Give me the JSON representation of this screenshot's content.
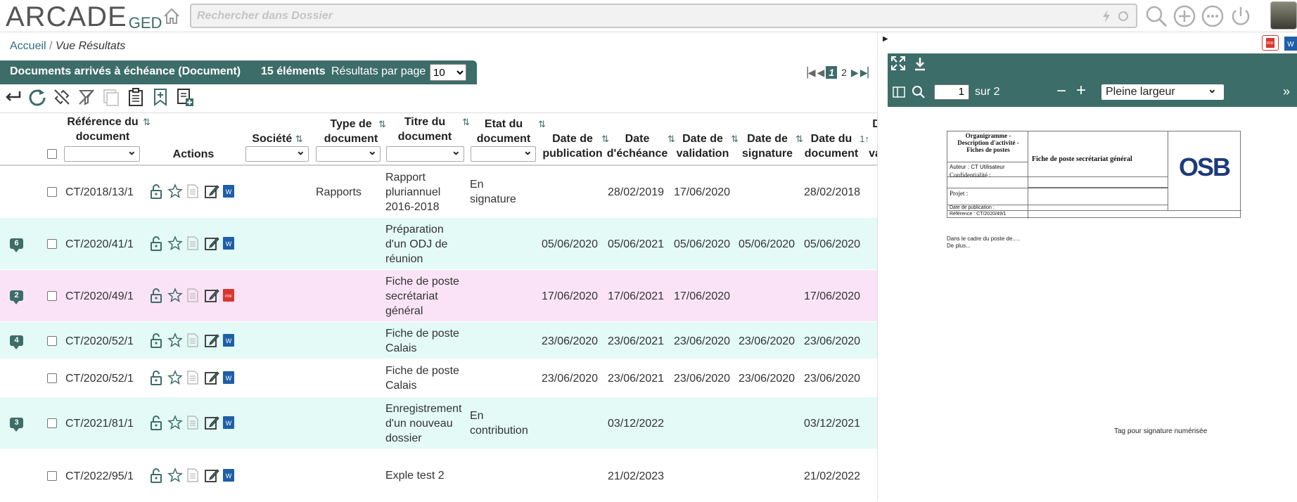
{
  "app": {
    "logo_text": "ARCADE",
    "logo_sub": "GED",
    "search_placeholder": "Rechercher dans Dossier"
  },
  "breadcrumb": {
    "home": "Accueil",
    "separator": "/",
    "current": "Vue Résultats"
  },
  "results": {
    "title": "Documents arrivés à échéance (Document)",
    "count": "15 éléments",
    "per_page_label": "Résultats par page",
    "per_page_value": "10",
    "per_page_options": [
      "10"
    ],
    "pages": [
      "1",
      "2"
    ],
    "current_page": "1"
  },
  "columns": {
    "reference": "Référence du document",
    "actions": "Actions",
    "societe": "Société",
    "type": "Type de document",
    "titre": "Titre du document",
    "etat": "Etat du document",
    "publication": "Date de publication",
    "echeance": "Date d'échéance",
    "validation": "Date de validation",
    "signature": "Date de signature",
    "date_doc": "Date du document",
    "date_doc_sort": "1",
    "extra_d": "D",
    "extra_va": "va"
  },
  "rows": [
    {
      "badge": "",
      "ref": "CT/2018/13/1",
      "type": "Rapports",
      "titre": [
        "Rapport",
        "pluriannuel",
        "2016-2018"
      ],
      "etat": [
        "En",
        "signature"
      ],
      "publication": "",
      "echeance": "28/02/2019",
      "validation": "17/06/2020",
      "signature": "",
      "date_doc": "28/02/2018",
      "filetype": "word",
      "bg": "#ffffff"
    },
    {
      "badge": "6",
      "ref": "CT/2020/41/1",
      "type": "",
      "titre": [
        "Préparation",
        "d'un ODJ de",
        "réunion"
      ],
      "etat": [],
      "publication": "05/06/2020",
      "echeance": "05/06/2021",
      "validation": "05/06/2020",
      "signature": "05/06/2020",
      "date_doc": "05/06/2020",
      "filetype": "word",
      "bg": "#e3faf6"
    },
    {
      "badge": "2",
      "ref": "CT/2020/49/1",
      "type": "",
      "titre": [
        "Fiche de poste",
        "secrétariat",
        "général"
      ],
      "etat": [],
      "publication": "17/06/2020",
      "echeance": "17/06/2021",
      "validation": "17/06/2020",
      "signature": "",
      "date_doc": "17/06/2020",
      "filetype": "pdf",
      "bg": "#fbe3f7"
    },
    {
      "badge": "4",
      "ref": "CT/2020/52/1",
      "type": "",
      "titre": [
        "Fiche de poste",
        "Calais"
      ],
      "etat": [],
      "publication": "23/06/2020",
      "echeance": "23/06/2021",
      "validation": "23/06/2020",
      "signature": "23/06/2020",
      "date_doc": "23/06/2020",
      "filetype": "word",
      "bg": "#e3faf6"
    },
    {
      "badge": "",
      "ref": "CT/2020/52/1",
      "type": "",
      "titre": [
        "Fiche de poste",
        "Calais"
      ],
      "etat": [],
      "publication": "23/06/2020",
      "echeance": "23/06/2021",
      "validation": "23/06/2020",
      "signature": "23/06/2020",
      "date_doc": "23/06/2020",
      "filetype": "word",
      "bg": "#ffffff"
    },
    {
      "badge": "3",
      "ref": "CT/2021/81/1",
      "type": "",
      "titre": [
        "Enregistrement",
        "d'un nouveau",
        "dossier"
      ],
      "etat": [
        "En",
        "contribution"
      ],
      "publication": "",
      "echeance": "03/12/2022",
      "validation": "",
      "signature": "",
      "date_doc": "03/12/2021",
      "filetype": "word",
      "bg": "#e3faf6"
    },
    {
      "badge": "",
      "ref": "CT/2022/95/1",
      "type": "",
      "titre": [
        "Exple test 2"
      ],
      "etat": [],
      "publication": "",
      "echeance": "21/02/2023",
      "validation": "",
      "signature": "",
      "date_doc": "21/02/2022",
      "filetype": "word",
      "bg": "#ffffff"
    }
  ],
  "viewer": {
    "page_value": "1",
    "page_total": "sur 2",
    "zoom_value": "Pleine largeur",
    "doc": {
      "header_left": "Organigramme - Description d'activité - Fiches de postes",
      "header_center": "Fiche de poste secrétariat général",
      "author": "Auteur : CT Utilisateur",
      "confidentiality": "Confidentialité :",
      "project": "Projet :",
      "pub_date": "Date de publication :",
      "reference": "Référence : CT/2020/49/1",
      "logo": "OSB",
      "body1": "Dans le cadre du poste de.....",
      "body2": "De plus...",
      "signature_tag": "Tag pour signature numérisée"
    }
  },
  "colors": {
    "accent": "#3d6d68",
    "row_teal": "#e3faf6",
    "row_pink": "#fbe3f7",
    "word": "#1f5ea8",
    "pdf": "#d9372d"
  }
}
